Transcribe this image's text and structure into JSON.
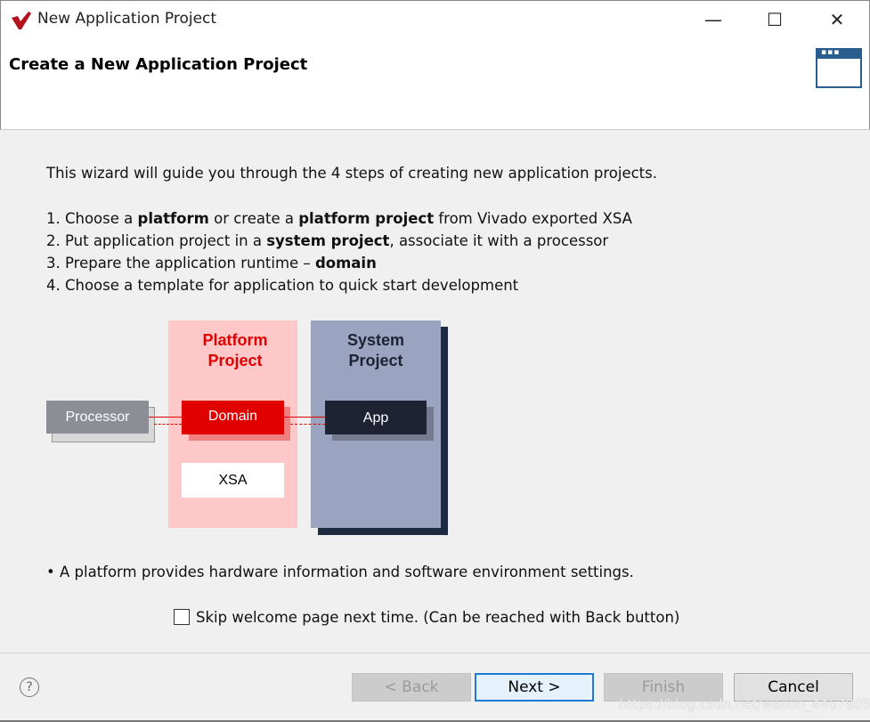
{
  "window": {
    "title": "New Application Project",
    "minimize": "—",
    "maximize": "☐",
    "close": "✕"
  },
  "header": {
    "title": "Create a New Application Project",
    "icon": "window-icon"
  },
  "intro": "This wizard will guide you through the 4 steps of creating new application projects.",
  "steps": [
    [
      {
        "t": "1.  Choose a "
      },
      {
        "t": "platform",
        "b": true
      },
      {
        "t": " or create a "
      },
      {
        "t": "platform project",
        "b": true
      },
      {
        "t": " from Vivado exported XSA"
      }
    ],
    [
      {
        "t": "2.  Put application project in a "
      },
      {
        "t": "system project",
        "b": true
      },
      {
        "t": ", associate it with a processor"
      }
    ],
    [
      {
        "t": "3.  Prepare the application runtime – "
      },
      {
        "t": "domain",
        "b": true
      }
    ],
    [
      {
        "t": "4.  Choose a template for application to quick start development"
      }
    ]
  ],
  "diagram": {
    "platform_line1": "Platform",
    "platform_line2": "Project",
    "system_line1": "System",
    "system_line2": "Project",
    "processor": "Processor",
    "domain": "Domain",
    "xsa": "XSA",
    "app": "App",
    "colors": {
      "platform": "#ffc8c8",
      "domain": "#e00000",
      "system": "#9aa4c0",
      "app": "#1e2233",
      "processor": "#8c8e96"
    }
  },
  "note": "• A platform provides hardware information and software environment settings.",
  "skip_checkbox": {
    "label": "Skip welcome page next time. (Can be reached with Back button)",
    "checked": false
  },
  "buttons": {
    "help": "?",
    "back": "< Back",
    "next": "Next >",
    "finish": "Finish",
    "cancel": "Cancel"
  },
  "watermark": "https://blog.csdn.net/weixin_44678052"
}
